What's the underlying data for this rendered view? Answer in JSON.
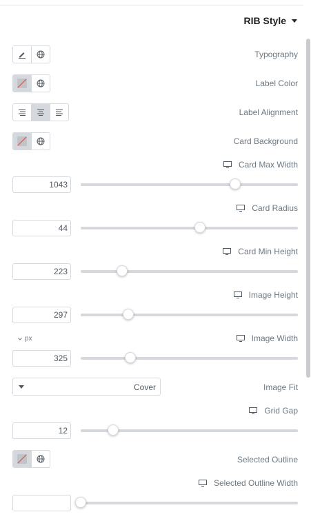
{
  "panel": {
    "title": "RIB Style"
  },
  "controls": {
    "typography": {
      "label": "Typography"
    },
    "label_color": {
      "label": "Label Color"
    },
    "label_alignment": {
      "label": "Label Alignment",
      "selected": "center"
    },
    "card_background": {
      "label": "Card Background"
    },
    "card_max_width": {
      "label": "Card Max Width",
      "value": "1043",
      "fraction": 0.71
    },
    "card_radius": {
      "label": "Card Radius",
      "value": "44",
      "fraction": 0.55
    },
    "card_min_height": {
      "label": "Card Min Height",
      "value": "223",
      "fraction": 0.19
    },
    "image_height": {
      "label": "Image Height",
      "value": "297",
      "fraction": 0.22
    },
    "image_width": {
      "label": "Image Width",
      "value": "325",
      "fraction": 0.23,
      "unit": "px"
    },
    "image_fit": {
      "label": "Image Fit",
      "value": "Cover"
    },
    "grid_gap": {
      "label": "Grid Gap",
      "value": "12",
      "fraction": 0.15
    },
    "selected_outline": {
      "label": "Selected Outline"
    },
    "selected_outline_width": {
      "label": "Selected Outline Width",
      "value": "",
      "fraction": 0.0
    }
  },
  "icons": {
    "responsive": "desktop-icon",
    "edit": "pencil-icon",
    "global": "globe-icon",
    "no_color": "no-color-icon"
  },
  "colors": {
    "accent": "#1f2124",
    "track": "#d5d8dc",
    "text": "#6d7882"
  }
}
